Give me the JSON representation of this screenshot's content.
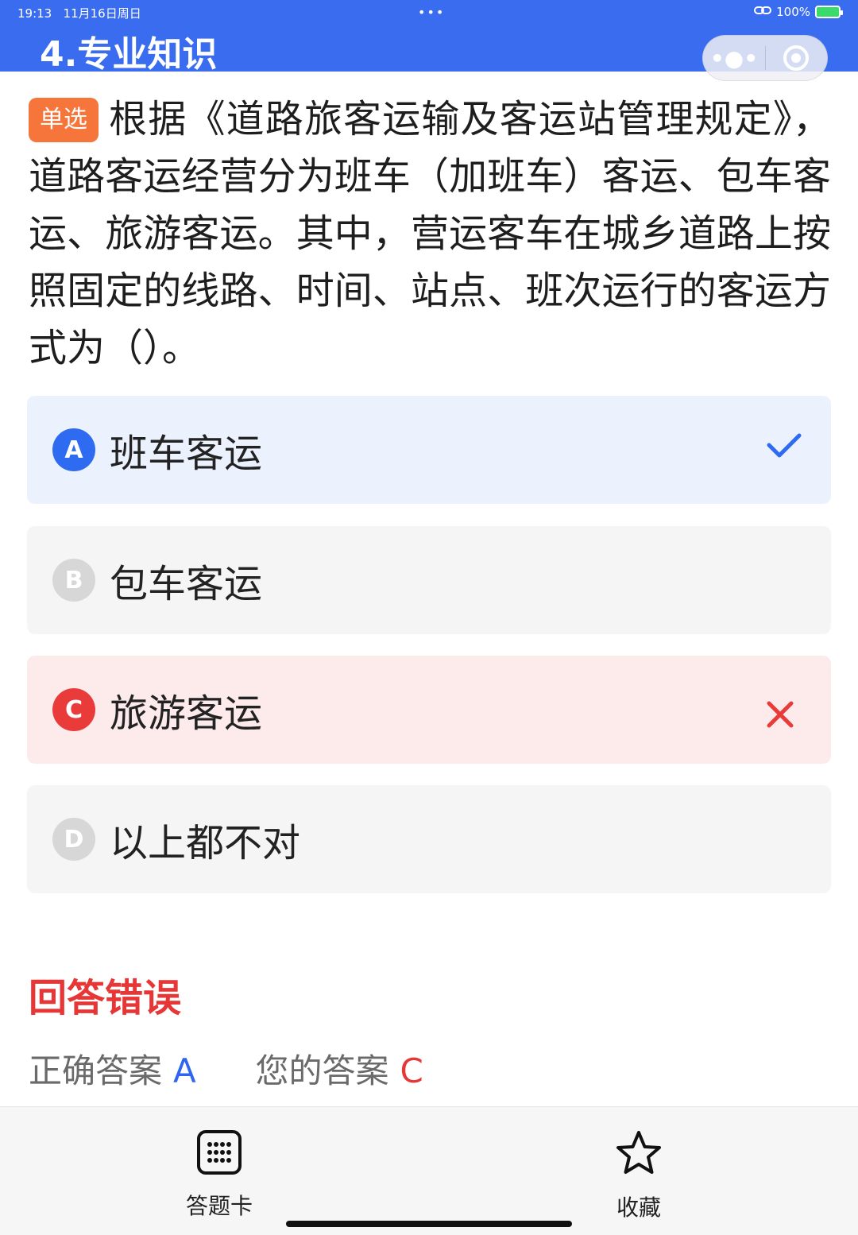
{
  "status_bar": {
    "time": "19:13",
    "date": "11月16日周日",
    "dots": "•••",
    "battery": "100%"
  },
  "header": {
    "title": "4.专业知识"
  },
  "question": {
    "type_badge": "单选",
    "text": "根据《道路旅客运输及客运站管理规定》，道路客运经营分为班车（加班车）客运、包车客运、旅游客运。其中，营运客车在城乡道路上按照固定的线路、时间、站点、班次运行的客运方式为（）。"
  },
  "options": [
    {
      "letter": "A",
      "text": "班车客运",
      "state": "correct"
    },
    {
      "letter": "B",
      "text": "包车客运",
      "state": "normal"
    },
    {
      "letter": "C",
      "text": "旅游客运",
      "state": "wrong"
    },
    {
      "letter": "D",
      "text": "以上都不对",
      "state": "normal"
    }
  ],
  "result": {
    "title": "回答错误",
    "correct_label": "正确答案",
    "correct_value": "A",
    "your_label": "您的答案",
    "your_value": "C"
  },
  "bottom_bar": {
    "answer_card": "答题卡",
    "favorite": "收藏"
  },
  "colors": {
    "header_blue": "#3a6cf0",
    "correct_blue": "#2e6bf0",
    "wrong_red": "#ea3b3b",
    "badge_orange": "#f5753b"
  }
}
